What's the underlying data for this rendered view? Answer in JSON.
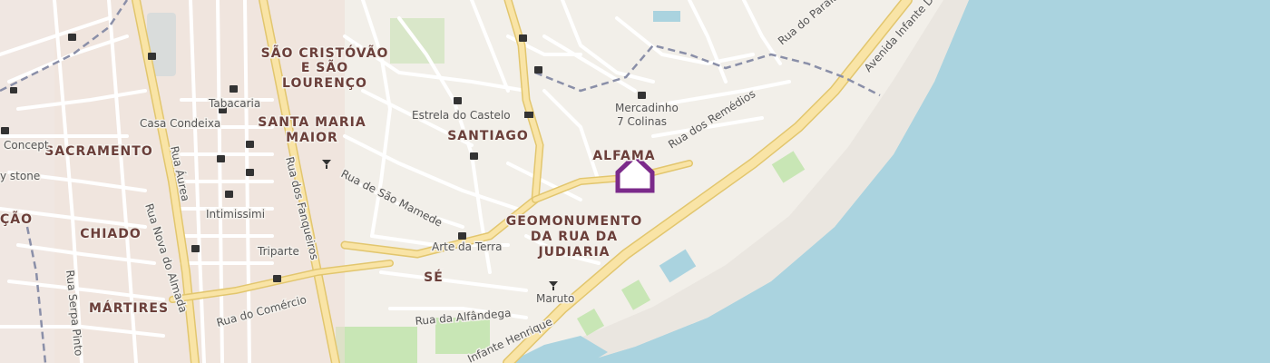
{
  "map": {
    "colors": {
      "land": "#f2efe9",
      "water": "#aad3df",
      "minor_road": "#ffffff",
      "major_road": "#f9e4a6",
      "major_casing": "#e2c66e",
      "border": "#8a8fa8",
      "marker": "#7b2a8a",
      "park": "#c8e6b5"
    },
    "districts": {
      "sao_cristovao_1": "SÃO CRISTÓVÃO",
      "sao_cristovao_2": "E SÃO",
      "sao_cristovao_3": "LOURENÇO",
      "santa_maria_1": "SANTA MARIA",
      "santa_maria_2": "MAIOR",
      "sacramento": "SACRAMENTO",
      "santiago": "SANTIAGO",
      "alfama": "ALFAMA",
      "geomonumento_1": "GEOMONUMENTO",
      "geomonumento_2": "DA RUA DA",
      "geomonumento_3": "JUDIARIA",
      "chiado": "CHIADO",
      "martires": "MÁRTIRES",
      "se": "SÉ",
      "cao_partial": "ÇÃO"
    },
    "streets": {
      "rua_augusta_partial": "Rua Áurea",
      "rua_fanqueiros": "Rua dos Fanqueiros",
      "rua_nova_almada": "Rua Nova do Almada",
      "rua_serpa_pinto": "Rua Serpa Pinto",
      "rua_sao_mamede": "Rua de São Mamede",
      "rua_comercio": "Rua do Comércio",
      "rua_alfandega": "Rua da Alfândega",
      "rua_remedios": "Rua dos Remédios",
      "avenida_infante": "Avenida Infante D",
      "rua_paraiso_partial": "Rua do Paraíso",
      "infante_henrique_partial": "Infante Henrique"
    },
    "pois": {
      "tabacaria": "Tabacaria",
      "casa_condeixa": "Casa Condeixa",
      "concept": "Concept",
      "stone": "y stone",
      "intimissimi": "Intimissimi",
      "triparte": "Triparte",
      "estrela": "Estrela do Castelo",
      "mercadinho_1": "Mercadinho",
      "mercadinho_2": "7 Colinas",
      "arte_terra": "Arte da Terra",
      "maruto": "Maruto"
    }
  }
}
